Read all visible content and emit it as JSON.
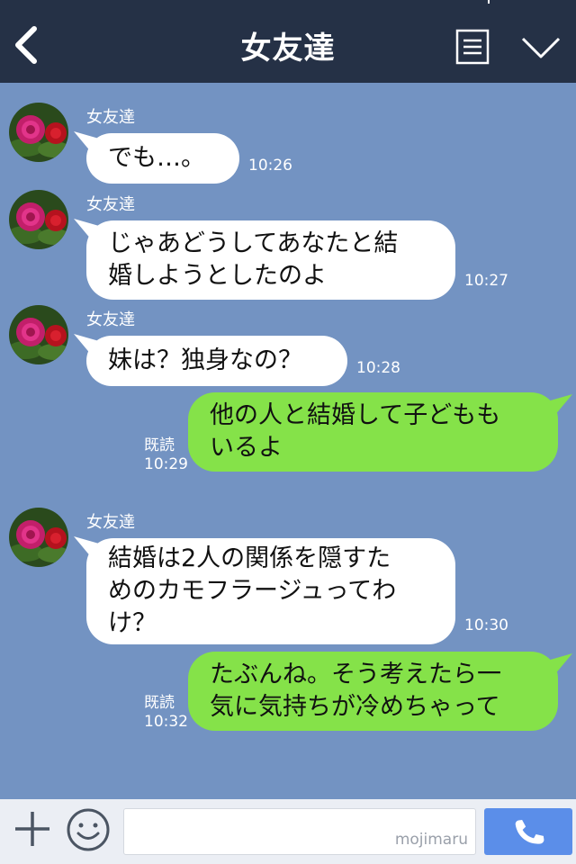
{
  "header": {
    "title": "女友達"
  },
  "messages": [
    {
      "type": "incoming",
      "sender": "女友達",
      "text": "でも…。",
      "time": "10:26"
    },
    {
      "type": "incoming",
      "sender": "女友達",
      "text": "じゃあどうしてあなたと結\n婚しようとしたのよ",
      "time": "10:27"
    },
    {
      "type": "incoming",
      "sender": "女友達",
      "text": "妹は？独身なの？",
      "time": "10:28"
    },
    {
      "type": "outgoing",
      "read": "既読",
      "text": "他の人と結婚して子どもも\nいるよ",
      "time": "10:29"
    },
    {
      "type": "incoming",
      "sender": "女友達",
      "text": "結婚は2人の関係を隠すた\nめのカモフラージュってわ\nけ？",
      "time": "10:30"
    },
    {
      "type": "outgoing",
      "read": "既読",
      "text": "たぶんね。そう考えたら一\n気に気持ちが冷めちゃって",
      "time": "10:32"
    }
  ],
  "input": {
    "placeholder": "",
    "watermark": "mojimaru"
  },
  "icons": {
    "back": "back-chevron-icon",
    "menu": "menu-list-icon",
    "collapse": "chevron-down-icon",
    "add": "plus-icon",
    "sticker": "smiley-icon",
    "send": "phone-call-icon"
  },
  "colors": {
    "header_bg": "#253146",
    "chat_bg": "#7393c2",
    "incoming_bubble": "#ffffff",
    "outgoing_bubble": "#85e249",
    "send_button": "#5b8ee9"
  }
}
